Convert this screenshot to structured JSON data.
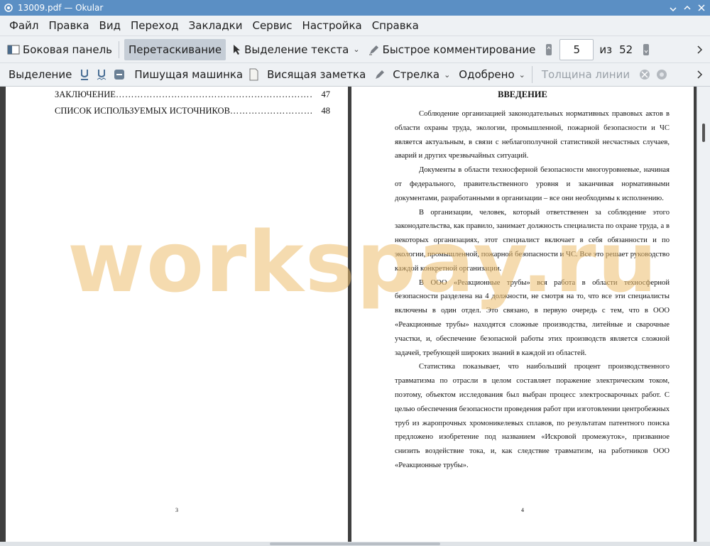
{
  "window": {
    "title": "13009.pdf  — Okular"
  },
  "menu": [
    "Файл",
    "Правка",
    "Вид",
    "Переход",
    "Закладки",
    "Сервис",
    "Настройка",
    "Справка"
  ],
  "toolbar1": {
    "sidebar": "Боковая панель",
    "drag": "Перетаскивание",
    "text_select": "Выделение текста",
    "quick_annot": "Быстрое комментирование",
    "page_current": "5",
    "page_of": "из",
    "page_total": "52"
  },
  "toolbar2": {
    "highlight": "Выделение",
    "typewriter": "Пишущая машинка",
    "popup_note": "Висящая заметка",
    "arrow": "Стрелка",
    "stamp": "Одобрено",
    "line_width": "Толщина линии"
  },
  "left_page": {
    "toc": [
      {
        "title": "ЗАКЛЮЧЕНИЕ",
        "page": "47"
      },
      {
        "title": "СПИСОК ИСПОЛЬЗУЕМЫХ ИСТОЧНИКОВ",
        "page": "48"
      }
    ],
    "page_number": "3"
  },
  "right_page": {
    "heading": "ВВЕДЕНИЕ",
    "paragraphs": [
      "Соблюдение организацией законодательных нормативных правовых актов в области охраны труда, экологии, промышленной, пожарной безопасности и ЧС является актуальным, в связи с неблагополучной статистикой несчастных случаев, аварий и других чрезвычайных ситуаций.",
      "Документы в области техносферной безопасности многоуровневые, начиная от федерального, правительственного уровня и заканчивая нормативными документами, разработанными в организации – все они необходимы к исполнению.",
      "В организации, человек, который ответственен за соблюдение этого законодательства, как правило, занимает должность специалиста по охране труда, а в некоторых организациях, этот специалист включает в себя обязанности и по экологии, промышленной, пожарной безопасности и ЧС. Все это решает руководство каждой конкретной организации.",
      "В ООО «Реакционные трубы» вся работа в области техносферной безопасности разделена на 4 должности, не смотря на то, что все эти специалисты включены в один отдел. Это связано, в первую очередь с тем, что в ООО «Реакционные трубы» находятся сложные производства, литейные и сварочные участки, и, обеспечение безопасной работы этих производств является сложной задачей, требующей широких знаний в каждой из областей.",
      "Статистика показывает, что наибольший процент производственного травматизма по отрасли в целом составляет поражение электрическим током, поэтому, объектом исследования был выбран процесс электросварочных работ. С целью обеспечения безопасности проведения работ при изготовлении центробежных труб из жаропрочных хромоникелевых сплавов, по результатам патентного поиска предложено изобретение под названием «Искровой промежуток», призванное снизить воздействие тока, и, как следствие травматизм, на работников ООО «Реакционные трубы»."
    ],
    "page_number": "4"
  },
  "watermark": "workspay.ru"
}
